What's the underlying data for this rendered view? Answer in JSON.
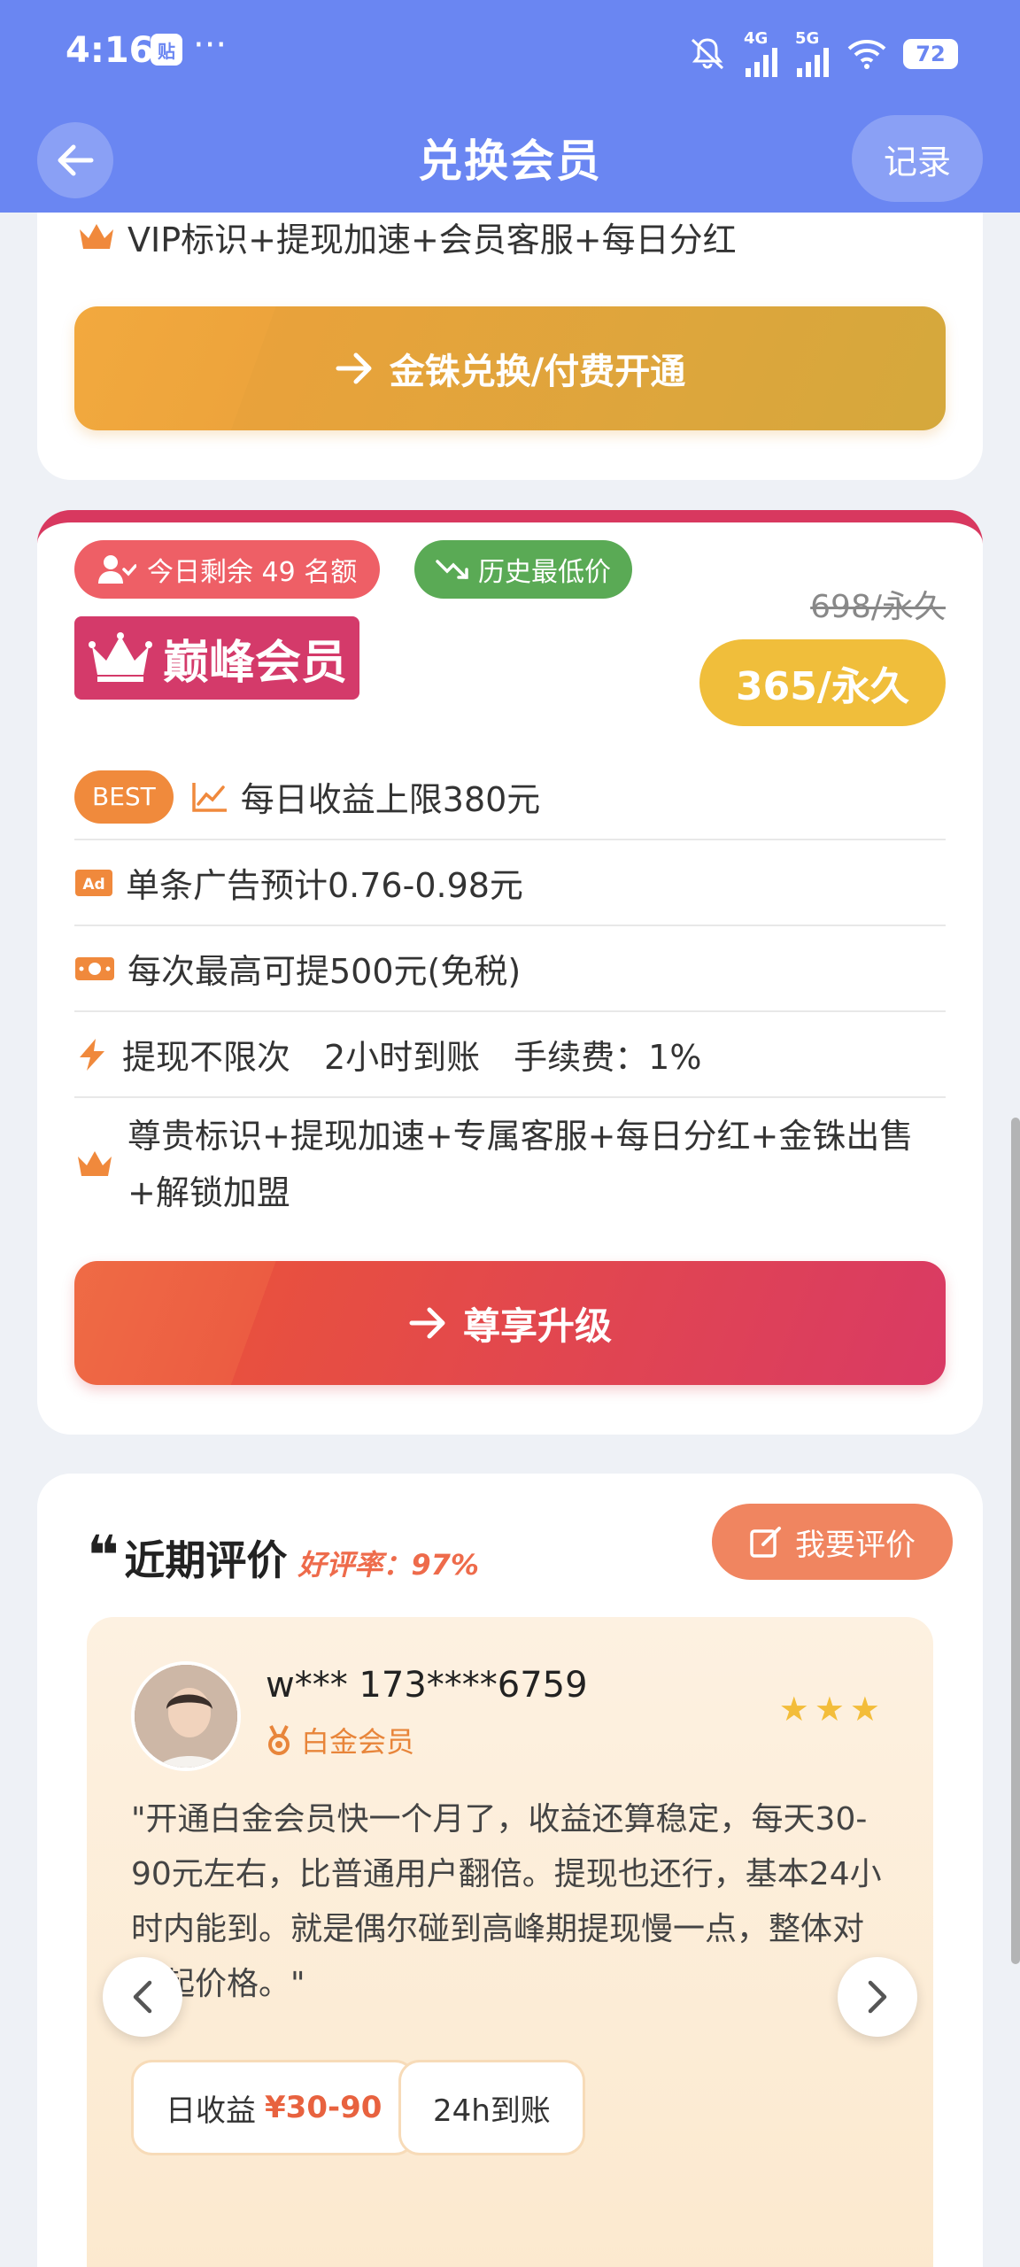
{
  "status": {
    "time": "4:16",
    "app_badge": "贴",
    "more": "···",
    "net_left": "4G",
    "net_right": "5G",
    "battery": "72"
  },
  "nav": {
    "title": "兑换会员",
    "record": "记录"
  },
  "prev_card": {
    "feature": "VIP标识+提现加速+会员客服+每日分红",
    "button": "金铢兑换/付费开通"
  },
  "peak_card": {
    "remain_tag": "今日剩余 49 名额",
    "low_tag": "历史最低价",
    "badge": "巅峰会员",
    "price_old": "698/永久",
    "price_now": "365/永久",
    "best_label": "BEST",
    "features": [
      "每日收益上限380元",
      "单条广告预计0.76-0.98元",
      "每次最高可提500元(免税)",
      "提现不限次　2小时到账　手续费：1%",
      "尊贵标识+提现加速+专属客服+每日分红+金铢出售+解锁加盟"
    ],
    "button": "尊享升级"
  },
  "reviews": {
    "quote_mark": "❝",
    "heading": "近期评价",
    "rate": "好评率：97%",
    "write_button": "我要评价",
    "item": {
      "name": "w*** 173****6759",
      "level": "白金会员",
      "stars": "★★★",
      "text": "\"开通白金会员快一个月了，收益还算稳定，每天30-90元左右，比普通用户翻倍。提现也还行，基本24小时内能到。就是偶尔碰到高峰期提现慢一点，整体对得起价格。\"",
      "pill_income_label": "日收益",
      "pill_income_value": "¥30-90",
      "pill_arrival": "24h到账"
    }
  },
  "colors": {
    "header": "#6a86f2",
    "accent_red": "#d8385f",
    "gold": "#f0be3b"
  }
}
